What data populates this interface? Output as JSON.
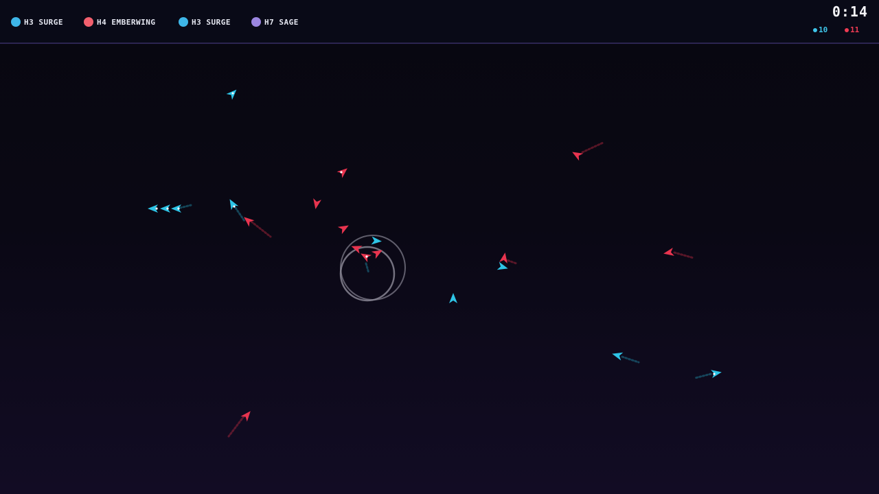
{
  "players": [
    {
      "label": "H3 SURGE",
      "color": "#3eb6e8"
    },
    {
      "label": "H4 EMBERWING",
      "color": "#f2606e"
    },
    {
      "label": "H3 SURGE",
      "color": "#3eb6e8"
    },
    {
      "label": "H7 SAGE",
      "color": "#9b86e0"
    }
  ],
  "timer": "0:14",
  "scores": {
    "cyan": {
      "value": "10",
      "color": "#3fc6ea"
    },
    "red": {
      "value": "11",
      "color": "#ef3b53"
    }
  },
  "colors": {
    "cyan_ship": "#2ec4e6",
    "red_ship": "#e8344f",
    "ring": "#8a8896"
  }
}
